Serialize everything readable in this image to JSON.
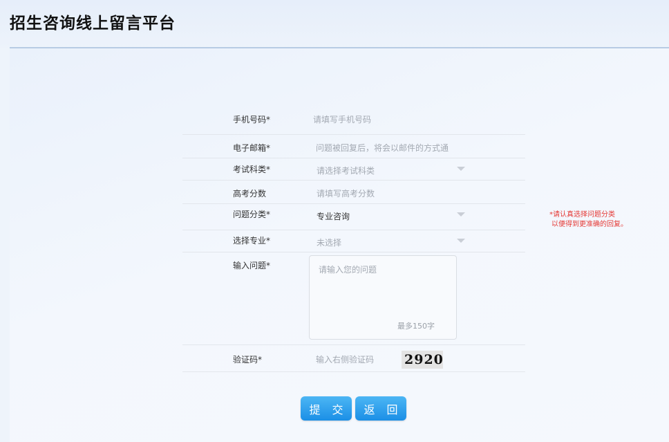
{
  "header": {
    "title": "招生咨询线上留言平台"
  },
  "form": {
    "phone": {
      "label": "手机号码*",
      "placeholder": "请填写手机号码"
    },
    "email": {
      "label": "电子邮箱*",
      "placeholder": "问题被回复后，将会以邮件的方式通"
    },
    "subject": {
      "label": "考试科类*",
      "value": "请选择考试科类"
    },
    "score": {
      "label": "高考分数",
      "placeholder": "请填写高考分数"
    },
    "category": {
      "label": "问题分类*",
      "value": "专业咨询",
      "note_line1": "*请认真选择问题分类",
      "note_line2": "以便得到更准确的回复。"
    },
    "major": {
      "label": "选择专业*",
      "value": "未选择"
    },
    "question": {
      "label": "输入问题*",
      "placeholder": "请输入您的问题",
      "limit": "最多150字"
    },
    "captcha": {
      "label": "验证码*",
      "placeholder": "输入右侧验证码",
      "image_text": "2920"
    }
  },
  "buttons": {
    "submit": "提 交",
    "back": "返 回"
  },
  "colors": {
    "button": "#1b8fe6",
    "note": "#e53935",
    "header_line": "#b7cbe4"
  }
}
